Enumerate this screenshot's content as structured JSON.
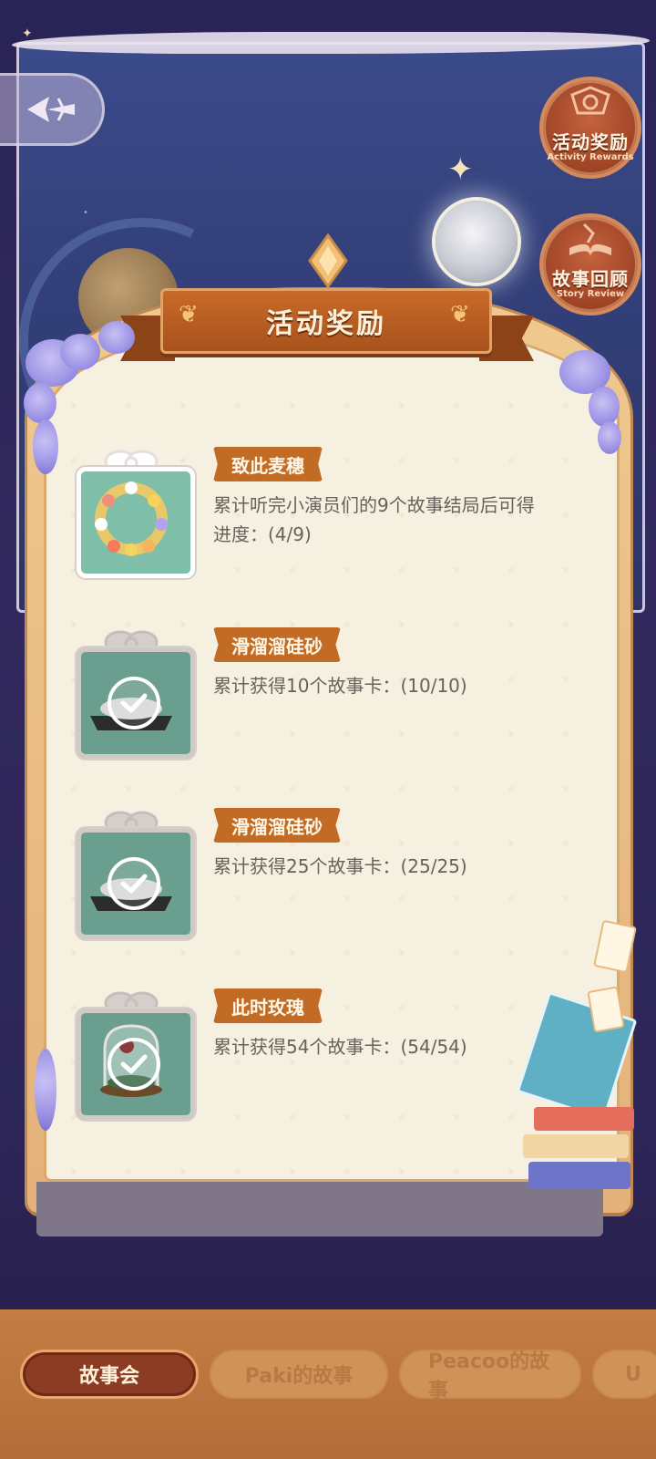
{
  "header": {
    "back_icon": "back-arrow-icon"
  },
  "side_buttons": [
    {
      "label": "活动奖励",
      "sub": "Activity Rewards",
      "icon": "medal-icon"
    },
    {
      "label": "故事回顾",
      "sub": "Story Review",
      "icon": "open-book-icon"
    }
  ],
  "panel": {
    "title": "活动奖励",
    "rewards": [
      {
        "name": "致此麦穗",
        "description": "累计听完小演员们的9个故事结局后可得",
        "progress": "进度：(4/9)",
        "claimed": false,
        "icon": "wreath-gift-icon"
      },
      {
        "name": "滑溜溜硅砂",
        "description": "累计获得10个故事卡：(10/10)",
        "claimed": true,
        "icon": "sand-gift-icon"
      },
      {
        "name": "滑溜溜硅砂",
        "description": "累计获得25个故事卡：(25/25)",
        "claimed": true,
        "icon": "sand-gift-icon"
      },
      {
        "name": "此时玫瑰",
        "description": "累计获得54个故事卡：(54/54)",
        "claimed": true,
        "icon": "rose-dome-gift-icon"
      }
    ]
  },
  "tabs": [
    {
      "label": "故事会",
      "active": true
    },
    {
      "label": "Paki的故事",
      "active": false
    },
    {
      "label": "Peacoo的故事",
      "active": false
    },
    {
      "label": "U",
      "active": false
    }
  ],
  "colors": {
    "accent": "#c16b25",
    "panel_bg": "#f6f0e1",
    "night_bg": "#2a2456",
    "tab_active": "#8c3c22"
  }
}
